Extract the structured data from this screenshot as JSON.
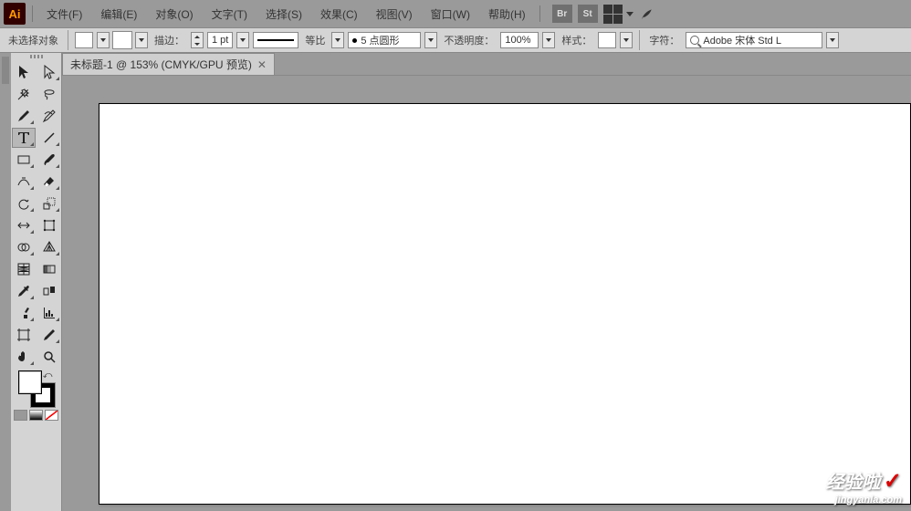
{
  "menu": {
    "file": "文件(F)",
    "edit": "编辑(E)",
    "object": "对象(O)",
    "type": "文字(T)",
    "select": "选择(S)",
    "effect": "效果(C)",
    "view": "视图(V)",
    "window": "窗口(W)",
    "help": "帮助(H)",
    "br": "Br",
    "st": "St"
  },
  "options": {
    "no_selection": "未选择对象",
    "stroke_label": "描边：",
    "stroke_weight": "1 pt",
    "uniform": "等比",
    "brush_def": "5 点圆形",
    "opacity_label": "不透明度：",
    "opacity_value": "100%",
    "style_label": "样式：",
    "char_label": "字符：",
    "font_name": "Adobe 宋体 Std L"
  },
  "doc": {
    "tab_title": "未标题-1 @ 153% (CMYK/GPU 预览)"
  },
  "watermark": {
    "brand": "经验啦",
    "url": "jingyanla.com"
  }
}
